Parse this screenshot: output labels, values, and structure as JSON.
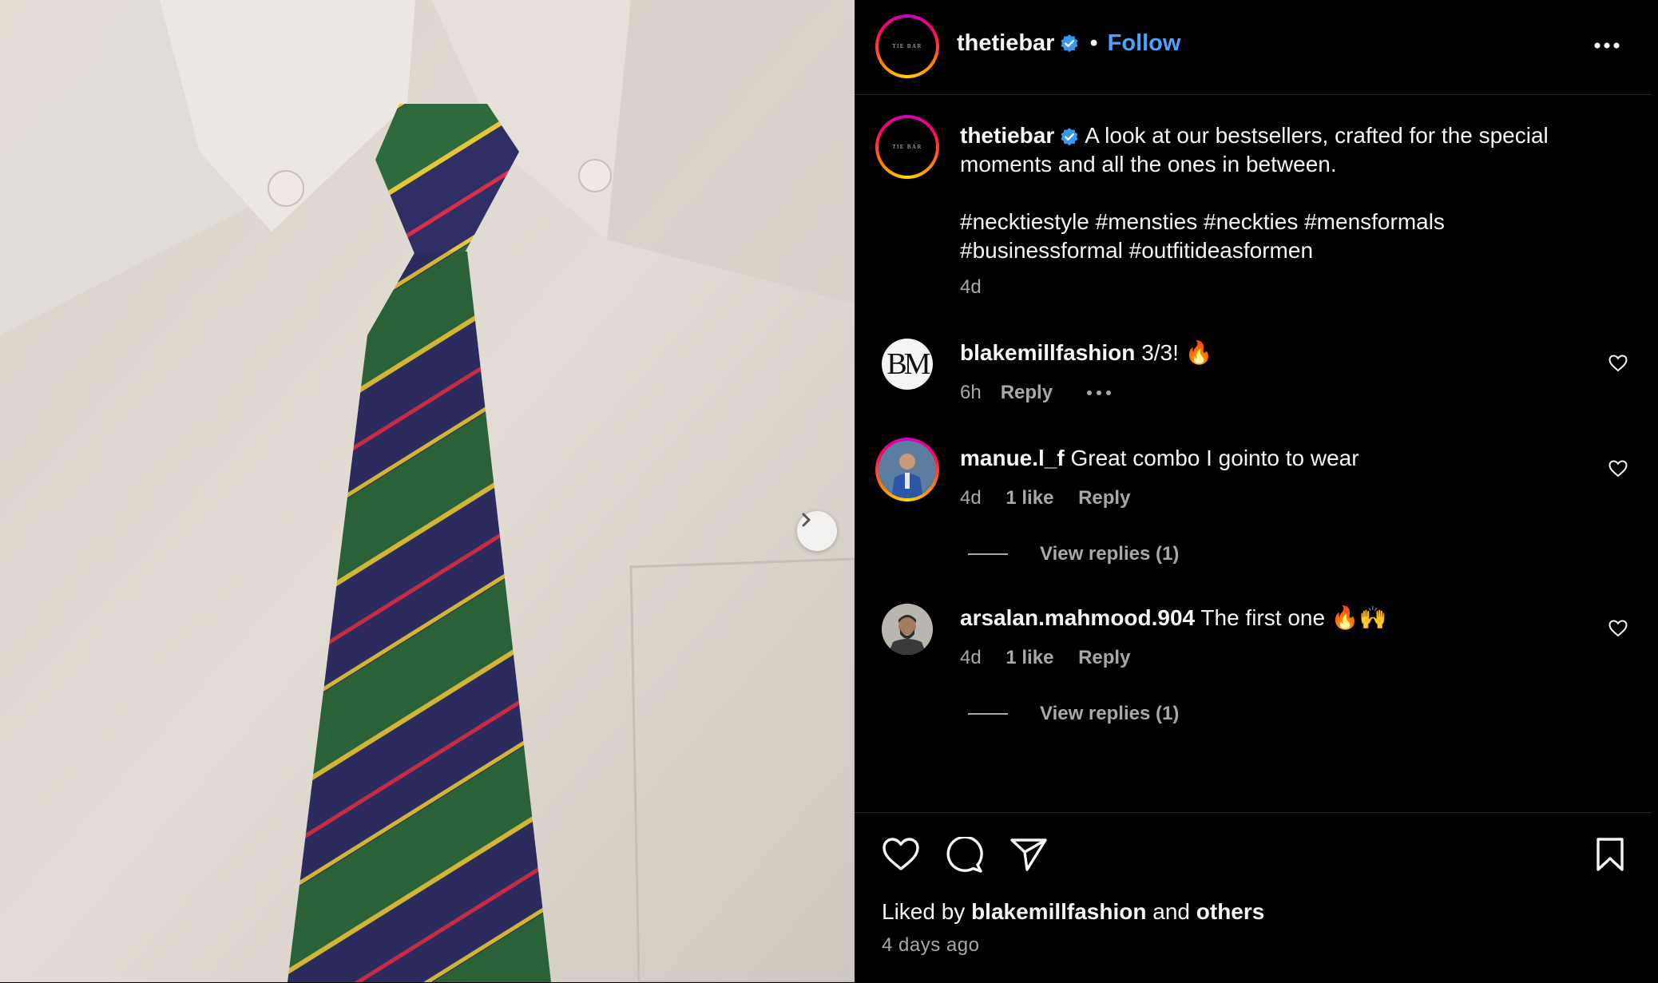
{
  "post": {
    "username": "thetiebar",
    "follow_label": "Follow",
    "separator": "•",
    "avatar_logo_text": "TIE BAR"
  },
  "caption": {
    "username": "thetiebar",
    "text": "A look at our bestsellers, crafted for the special moments and all the ones in between.",
    "hashtags": "#necktiestyle #mensties #neckties #mensformals #businessformal #outfitideasformen",
    "time": "4d"
  },
  "comments": [
    {
      "username": "blakemillfashion",
      "text": "3/3! 🔥",
      "time": "6h",
      "reply_label": "Reply",
      "avatar_text": "BM"
    },
    {
      "username": "manue.l_f",
      "text": "Great combo I gointo to wear",
      "time": "4d",
      "likes": "1 like",
      "reply_label": "Reply",
      "view_replies": "View replies (1)"
    },
    {
      "username": "arsalan.mahmood.904",
      "text": "The first one 🔥🙌",
      "time": "4d",
      "likes": "1 like",
      "reply_label": "Reply",
      "view_replies": "View replies (1)"
    }
  ],
  "footer": {
    "liked_prefix": "Liked by",
    "liked_user": "blakemillfashion",
    "liked_and": "and",
    "liked_others": "others",
    "time_ago": "4 days ago"
  },
  "icons": {
    "verified": "verified-badge-icon",
    "more": "more-options-icon",
    "next": "chevron-right-icon",
    "like": "heart-icon",
    "comment": "comment-icon",
    "share": "send-icon",
    "save": "bookmark-icon"
  },
  "colors": {
    "background": "#000000",
    "accent_link": "#4aa3ff",
    "verified": "#3897f0",
    "muted_text": "#a8a8a8",
    "divider": "#262626"
  }
}
